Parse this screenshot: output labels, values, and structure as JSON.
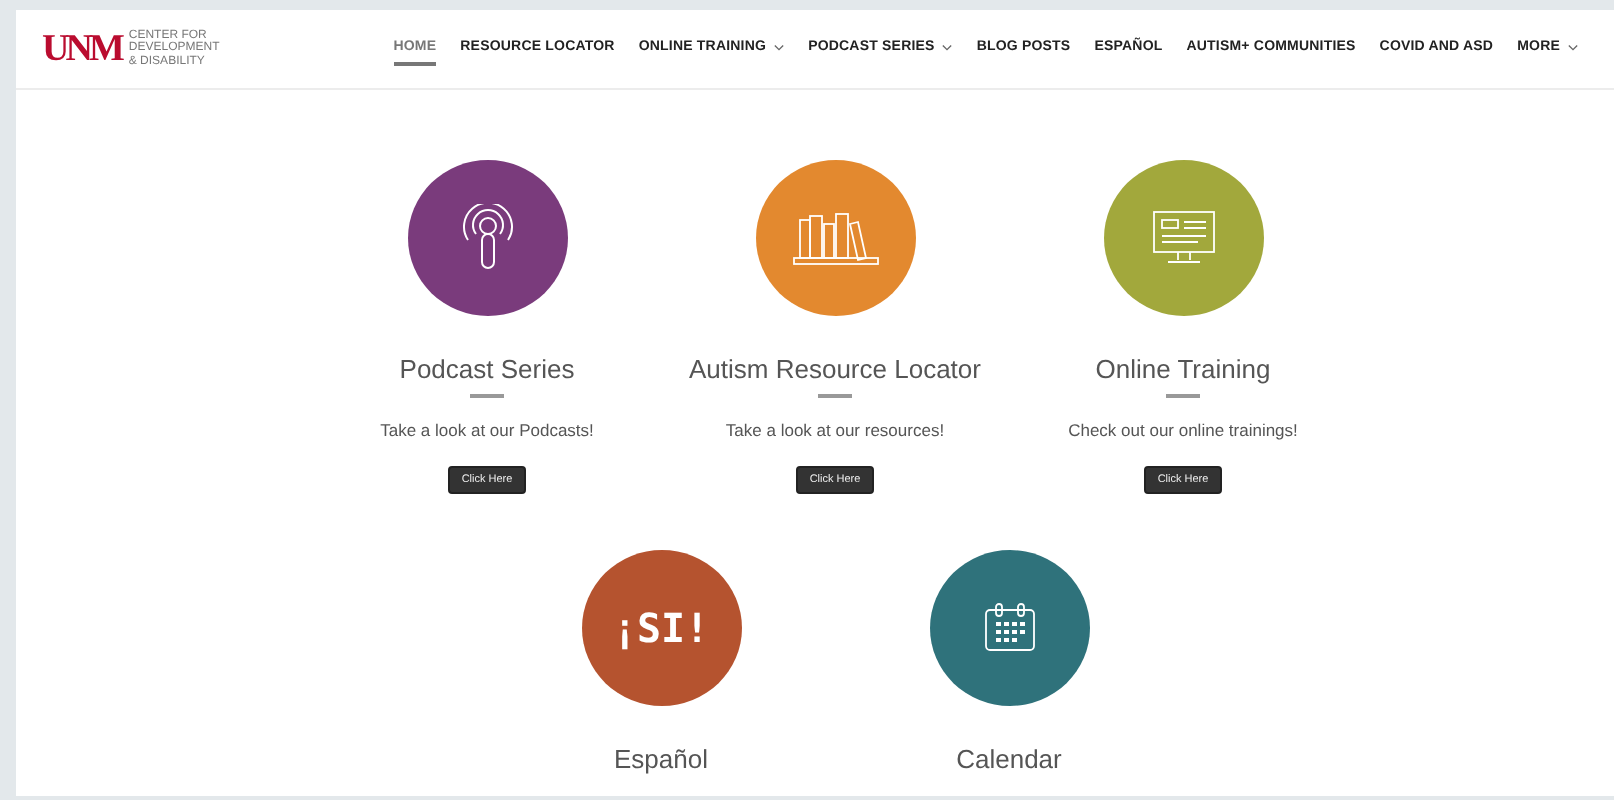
{
  "header": {
    "logo_mark": "UNM",
    "logo_lines": [
      "CENTER FOR",
      "DEVELOPMENT",
      "& DISABILITY"
    ]
  },
  "nav": [
    {
      "label": "HOME",
      "selected": true,
      "has_menu": false
    },
    {
      "label": "RESOURCE LOCATOR",
      "selected": false,
      "has_menu": false
    },
    {
      "label": "ONLINE TRAINING",
      "selected": false,
      "has_menu": true
    },
    {
      "label": "PODCAST SERIES",
      "selected": false,
      "has_menu": true
    },
    {
      "label": "BLOG POSTS",
      "selected": false,
      "has_menu": false
    },
    {
      "label": "ESPAÑOL",
      "selected": false,
      "has_menu": false
    },
    {
      "label": "AUTISM+ COMMUNITIES",
      "selected": false,
      "has_menu": false
    },
    {
      "label": "COVID AND ASD",
      "selected": false,
      "has_menu": false
    },
    {
      "label": "MORE",
      "selected": false,
      "has_menu": true
    }
  ],
  "card_rows": [
    [
      {
        "kind": "podcast",
        "color": "#7a3b7c",
        "title": "Podcast Series",
        "description": "Take a look at our Podcasts!",
        "button": "Click Here"
      },
      {
        "kind": "books",
        "color": "#e3892f",
        "title": "Autism Resource Locator",
        "description": "Take a look at our resources!",
        "button": "Click Here"
      },
      {
        "kind": "monitor",
        "color": "#a2a83c",
        "title": "Online Training",
        "description": "Check out our online trainings!",
        "button": "Click Here"
      }
    ],
    [
      {
        "kind": "text",
        "color": "#b5532f",
        "badge_text": "¡SI!",
        "title": "Español"
      },
      {
        "kind": "calendar",
        "color": "#2f727b",
        "title": "Calendar"
      }
    ]
  ]
}
